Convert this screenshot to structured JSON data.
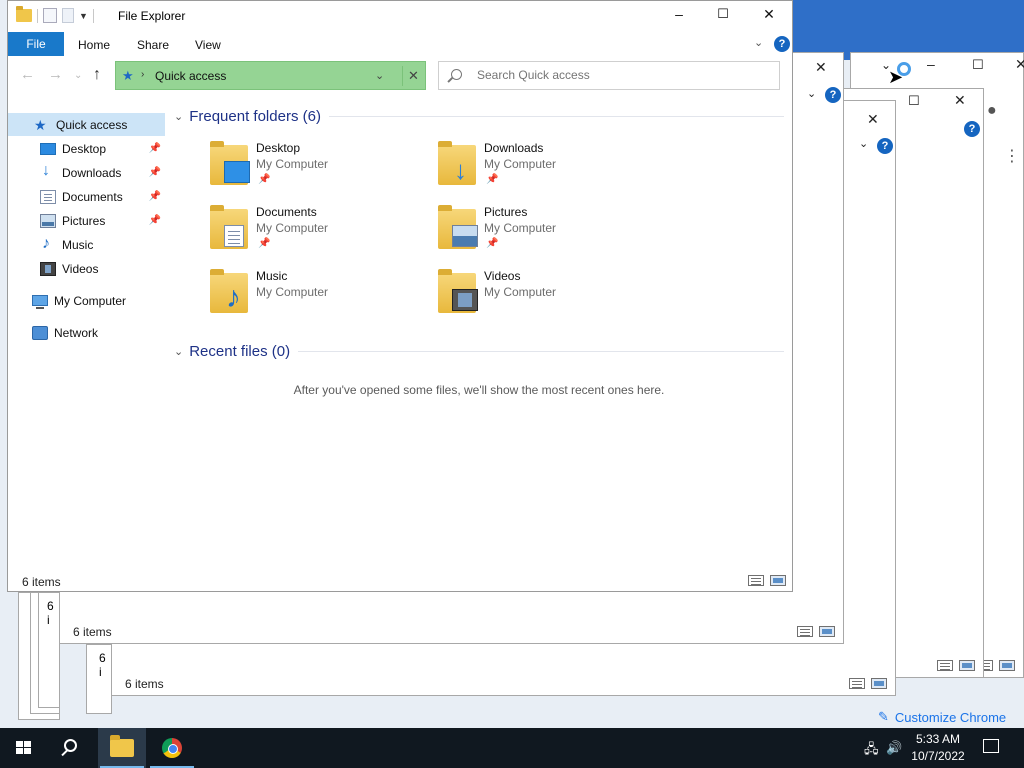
{
  "window": {
    "title": "File Explorer"
  },
  "ribbon": {
    "file_tab": "File",
    "tabs": [
      "Home",
      "Share",
      "View"
    ],
    "help": "?"
  },
  "address": {
    "location": "Quick access"
  },
  "search": {
    "placeholder": "Search Quick access"
  },
  "navpane": {
    "quick_access": "Quick access",
    "pinned": [
      "Desktop",
      "Downloads",
      "Documents",
      "Pictures"
    ],
    "unpinned": [
      "Music",
      "Videos"
    ],
    "my_computer": "My Computer",
    "network": "Network"
  },
  "frequent": {
    "title": "Frequent folders (6)",
    "items": [
      {
        "name": "Desktop",
        "location": "My Computer",
        "icon": "desktop-folder-icon",
        "pinned": true
      },
      {
        "name": "Downloads",
        "location": "My Computer",
        "icon": "downloads-folder-icon",
        "pinned": true
      },
      {
        "name": "Documents",
        "location": "My Computer",
        "icon": "documents-folder-icon",
        "pinned": true
      },
      {
        "name": "Pictures",
        "location": "My Computer",
        "icon": "pictures-folder-icon",
        "pinned": true
      },
      {
        "name": "Music",
        "location": "My Computer",
        "icon": "music-folder-icon",
        "pinned": false
      },
      {
        "name": "Videos",
        "location": "My Computer",
        "icon": "videos-folder-icon",
        "pinned": false
      }
    ]
  },
  "recent": {
    "title": "Recent files (0)",
    "empty_message": "After you've opened some files, we'll show the most recent ones here."
  },
  "status": {
    "items_text": "6 items"
  },
  "background_windows": {
    "status_texts": [
      "6 items",
      "6 items"
    ],
    "partial_status": "6 i"
  },
  "chrome": {
    "customize_label": "Customize Chrome"
  },
  "taskbar": {
    "time": "5:33 AM",
    "date": "10/7/2022",
    "apps": [
      "File Explorer",
      "Google Chrome"
    ]
  },
  "colors": {
    "accent": "#1979ca",
    "address_highlight": "#95d494",
    "group_title": "#1e3287",
    "taskbar": "#101820"
  }
}
